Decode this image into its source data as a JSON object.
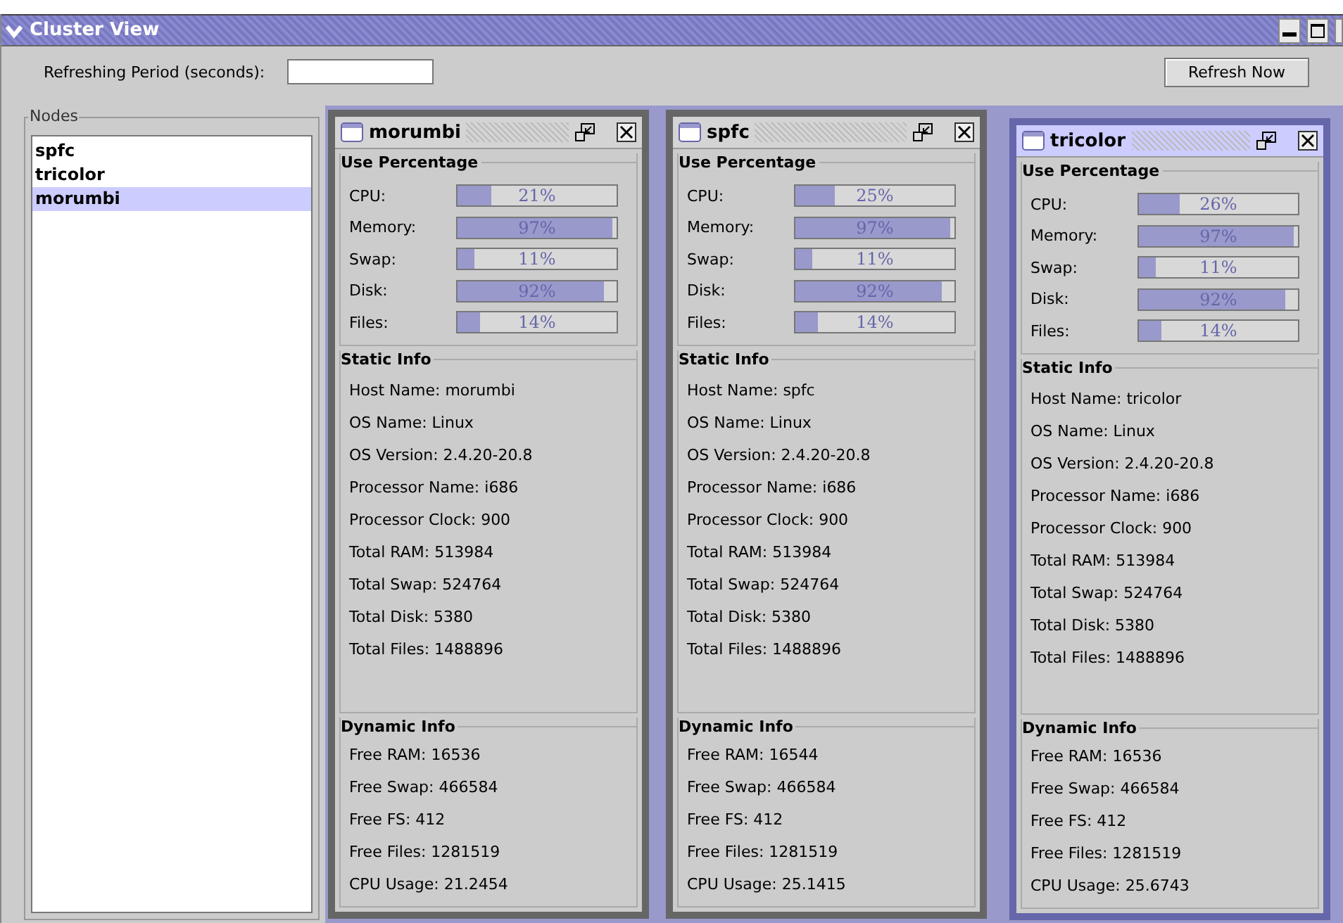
{
  "window": {
    "title": "Cluster View"
  },
  "toolbar": {
    "period_label": "Refreshing Period (seconds):",
    "button": "Refresh Now"
  },
  "nodes": {
    "title": "Nodes",
    "items": [
      {
        "label": "spfc",
        "selected": false
      },
      {
        "label": "tricolor",
        "selected": false
      },
      {
        "label": "morumbi",
        "selected": true
      }
    ]
  },
  "frames": [
    {
      "name": "morumbi",
      "selected": false,
      "usage_title": "Use Percentage",
      "usage": [
        {
          "label": "CPU:",
          "level": 0.21,
          "reading": "21%"
        },
        {
          "label": "Memory:",
          "level": 0.97,
          "reading": "97%"
        },
        {
          "label": "Swap:",
          "level": 0.11,
          "reading": "11%"
        },
        {
          "label": "Disk:",
          "level": 0.92,
          "reading": "92%"
        },
        {
          "label": "Files:",
          "level": 0.14,
          "reading": "14%"
        }
      ],
      "static_title": "Static Info",
      "static": [
        "Host Name: morumbi",
        "OS Name: Linux",
        "OS Version: 2.4.20-20.8",
        "Processor Name: i686",
        "Processor Clock: 900",
        "Total RAM: 513984",
        "Total Swap: 524764",
        "Total Disk: 5380",
        "Total Files: 1488896"
      ],
      "dynamic_title": "Dynamic Info",
      "dynamic": [
        "Free RAM: 16536",
        "Free Swap: 466584",
        "Free FS: 412",
        "Free Files: 1281519",
        "CPU Usage: 21.2454"
      ]
    },
    {
      "name": "spfc",
      "selected": false,
      "usage_title": "Use Percentage",
      "usage": [
        {
          "label": "CPU:",
          "level": 0.25,
          "reading": "25%"
        },
        {
          "label": "Memory:",
          "level": 0.97,
          "reading": "97%"
        },
        {
          "label": "Swap:",
          "level": 0.11,
          "reading": "11%"
        },
        {
          "label": "Disk:",
          "level": 0.92,
          "reading": "92%"
        },
        {
          "label": "Files:",
          "level": 0.14,
          "reading": "14%"
        }
      ],
      "static_title": "Static Info",
      "static": [
        "Host Name: spfc",
        "OS Name: Linux",
        "OS Version: 2.4.20-20.8",
        "Processor Name: i686",
        "Processor Clock: 900",
        "Total RAM: 513984",
        "Total Swap: 524764",
        "Total Disk: 5380",
        "Total Files: 1488896"
      ],
      "dynamic_title": "Dynamic Info",
      "dynamic": [
        "Free RAM: 16544",
        "Free Swap: 466584",
        "Free FS: 412",
        "Free Files: 1281519",
        "CPU Usage: 25.1415"
      ]
    },
    {
      "name": "tricolor",
      "selected": true,
      "usage_title": "Use Percentage",
      "usage": [
        {
          "label": "CPU:",
          "level": 0.26,
          "reading": "26%"
        },
        {
          "label": "Memory:",
          "level": 0.97,
          "reading": "97%"
        },
        {
          "label": "Swap:",
          "level": 0.11,
          "reading": "11%"
        },
        {
          "label": "Disk:",
          "level": 0.92,
          "reading": "92%"
        },
        {
          "label": "Files:",
          "level": 0.14,
          "reading": "14%"
        }
      ],
      "static_title": "Static Info",
      "static": [
        "Host Name: tricolor",
        "OS Name: Linux",
        "OS Version: 2.4.20-20.8",
        "Processor Name: i686",
        "Processor Clock: 900",
        "Total RAM: 513984",
        "Total Swap: 524764",
        "Total Disk: 5380",
        "Total Files: 1488896"
      ],
      "dynamic_title": "Dynamic Info",
      "dynamic": [
        "Free RAM: 16536",
        "Free Swap: 466584",
        "Free FS: 412",
        "Free Files: 1281519",
        "CPU Usage: 25.6743"
      ]
    }
  ]
}
